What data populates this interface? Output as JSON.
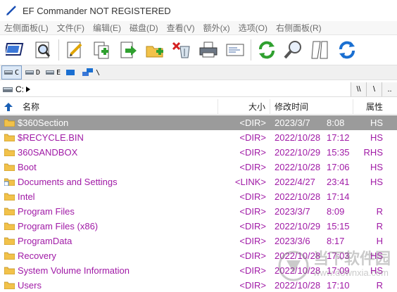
{
  "window": {
    "title": "EF Commander NOT REGISTERED"
  },
  "menu": [
    "左侧面板(L)",
    "文件(F)",
    "编辑(E)",
    "磁盘(D)",
    "查看(V)",
    "额外(x)",
    "选项(O)",
    "右侧面板(R)"
  ],
  "toolbar": {
    "buttons": [
      "view-icon",
      "find-icon",
      "edit-icon",
      "copy-icon",
      "move-icon",
      "new-folder-icon",
      "delete-icon",
      "print-icon",
      "properties-icon",
      "refresh-icon",
      "search-icon",
      "compare-icon",
      "sync-icon"
    ]
  },
  "drives": [
    {
      "label": "C",
      "active": true
    },
    {
      "label": "D",
      "active": false
    },
    {
      "label": "E",
      "active": false
    },
    {
      "label": "",
      "active": false
    },
    {
      "label": "\\",
      "active": false
    }
  ],
  "path": {
    "text": "C:",
    "btn_root": "\\\\",
    "btn_back": "\\",
    "btn_up": ".."
  },
  "columns": {
    "name": "名称",
    "size": "大小",
    "modified": "修改时间",
    "attr": "属性"
  },
  "files": [
    {
      "name": "$360Section",
      "size": "<DIR>",
      "date": "2023/3/7",
      "time": "8:08",
      "attr": "HS",
      "selected": true
    },
    {
      "name": "$RECYCLE.BIN",
      "size": "<DIR>",
      "date": "2022/10/28",
      "time": "17:12",
      "attr": "HS"
    },
    {
      "name": "360SANDBOX",
      "size": "<DIR>",
      "date": "2022/10/29",
      "time": "15:35",
      "attr": "RHS"
    },
    {
      "name": "Boot",
      "size": "<DIR>",
      "date": "2022/10/28",
      "time": "17:06",
      "attr": "HS"
    },
    {
      "name": "Documents and Settings",
      "size": "<LINK>",
      "date": "2022/4/27",
      "time": "23:41",
      "attr": "HS",
      "link": true
    },
    {
      "name": "Intel",
      "size": "<DIR>",
      "date": "2022/10/28",
      "time": "17:14",
      "attr": ""
    },
    {
      "name": "Program Files",
      "size": "<DIR>",
      "date": "2023/3/7",
      "time": "8:09",
      "attr": "R"
    },
    {
      "name": "Program Files (x86)",
      "size": "<DIR>",
      "date": "2022/10/29",
      "time": "15:15",
      "attr": "R"
    },
    {
      "name": "ProgramData",
      "size": "<DIR>",
      "date": "2023/3/6",
      "time": "8:17",
      "attr": "H"
    },
    {
      "name": "Recovery",
      "size": "<DIR>",
      "date": "2022/10/28",
      "time": "17:03",
      "attr": "HS"
    },
    {
      "name": "System Volume Information",
      "size": "<DIR>",
      "date": "2022/10/28",
      "time": "17:09",
      "attr": "HS"
    },
    {
      "name": "Users",
      "size": "<DIR>",
      "date": "2022/10/28",
      "time": "17:10",
      "attr": "R"
    }
  ],
  "watermark": {
    "text": "当下软件园",
    "url": "www.downxia.com"
  },
  "colors": {
    "file_text": "#a01aa6",
    "selected_bg": "#9b9b9b",
    "folder": "#f2c24a",
    "accent": "#1a6fd1"
  }
}
